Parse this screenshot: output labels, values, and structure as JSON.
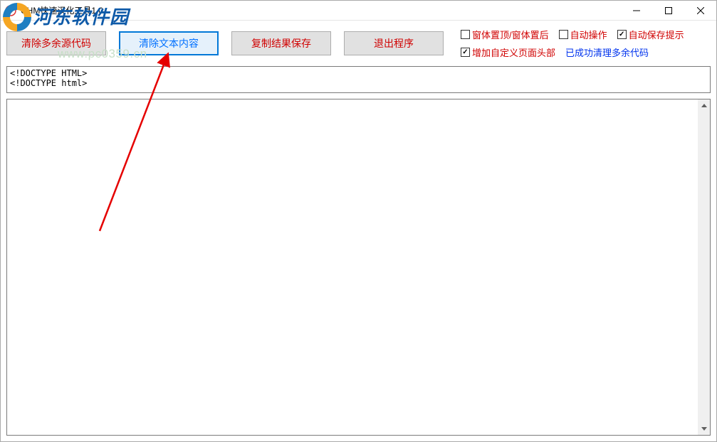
{
  "titlebar": {
    "title": "CHM快速汉化工具1.0"
  },
  "toolbar": {
    "btn_clear_code": "清除多余源代码",
    "btn_clear_text": "清除文本内容",
    "btn_copy_save": "复制结果保存",
    "btn_exit": "退出程序"
  },
  "checkboxes": {
    "form_topfront": {
      "label": "窗体置顶/窗体置后",
      "checked": false
    },
    "auto_action": {
      "label": "自动操作",
      "checked": false
    },
    "auto_save_prompt": {
      "label": "自动保存提示",
      "checked": true
    },
    "add_custom_header": {
      "label": "增加自定义页面头部",
      "checked": true
    }
  },
  "status_text": "已成功清理多余代码",
  "input_content": "<!DOCTYPE HTML>\n<!DOCTYPE html>",
  "watermark": {
    "site_name": "河东软件园",
    "url": "www.pc0359.cn"
  }
}
